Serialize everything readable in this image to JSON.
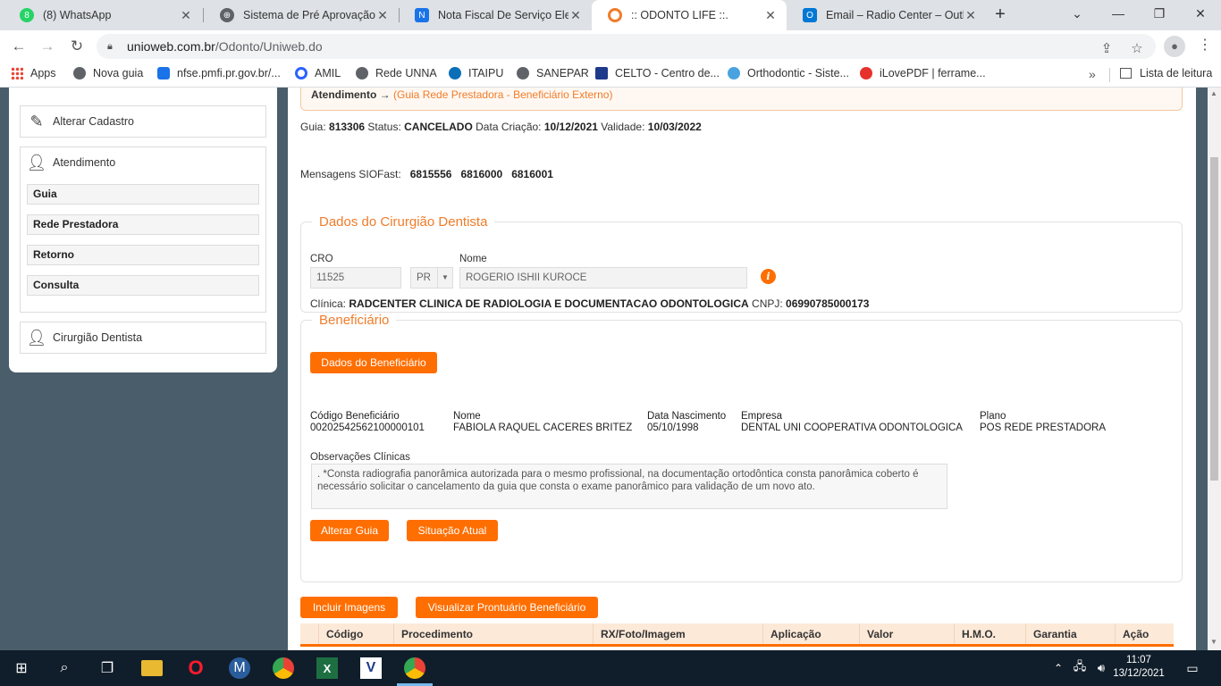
{
  "browser": {
    "tabs": [
      {
        "title": "(8) WhatsApp",
        "icon": "whatsapp-icon",
        "color": "#25d366",
        "active": false
      },
      {
        "title": "Sistema de Pré Aprovação",
        "icon": "globe-icon",
        "color": "#5f6368",
        "active": false
      },
      {
        "title": "Nota Fiscal De Serviço Eletrô",
        "icon": "nfse-icon",
        "color": "#1a73e8",
        "active": false
      },
      {
        "title": ":: ODONTO LIFE ::.",
        "icon": "odonto-icon",
        "color": "#f07c2a",
        "active": true
      },
      {
        "title": "Email – Radio Center – Outlo",
        "icon": "outlook-icon",
        "color": "#0078d4",
        "active": false
      }
    ],
    "new_tab": "+",
    "url_host": "unioweb.com.br",
    "url_path": "/Odonto/Uniweb.do",
    "bookmarks": [
      "Apps",
      "Nova guia",
      "nfse.pmfi.pr.gov.br/...",
      "AMIL",
      "Rede UNNA",
      "ITAIPU",
      "SANEPAR",
      "CELTO - Centro de...",
      "Orthodontic - Siste...",
      "iLovePDF | ferrame..."
    ],
    "reading_list": "Lista de leitura"
  },
  "sidebar": {
    "alterar_cadastro": "Alterar Cadastro",
    "atendimento": "Atendimento",
    "sub_items": [
      "Guia",
      "Rede Prestadora",
      "Retorno",
      "Consulta"
    ],
    "cirurgiao": "Cirurgião Dentista"
  },
  "main": {
    "breadcrumb_bold": "Atendimento →",
    "breadcrumb_sub": "(Guia Rede Prestadora - Beneficiário Externo)",
    "guia_label": "Guia:",
    "guia_value": "813306",
    "status_label": "Status:",
    "status_value": "CANCELADO",
    "criacao_label": "Data Criação:",
    "criacao_value": "10/12/2021",
    "validade_label": "Validade:",
    "validade_value": "10/03/2022",
    "mensagens_label": "Mensagens SIOFast:",
    "mensagens": [
      "6815556",
      "6816000",
      "6816001"
    ],
    "dentista": {
      "legend": "Dados do Cirurgião Dentista",
      "cro_label": "CRO",
      "cro_value": "11525",
      "uf_value": "PR",
      "nome_label": "Nome",
      "nome_value": "ROGERIO ISHII KUROCE",
      "clinica_label": "Clínica:",
      "clinica_value": "RADCENTER CLINICA DE RADIOLOGIA E DOCUMENTACAO ODONTOLOGICA",
      "cnpj_label": "CNPJ:",
      "cnpj_value": "06990785000173"
    },
    "beneficiario": {
      "legend": "Beneficiário",
      "dados_button": "Dados do Beneficiário",
      "codigo_label": "Código Beneficiário",
      "codigo_value": "00202542562100000101",
      "nome_label": "Nome",
      "nome_value": "FABIOLA RAQUEL CACERES BRITEZ",
      "nasc_label": "Data Nascimento",
      "nasc_value": "05/10/1998",
      "empresa_label": "Empresa",
      "empresa_value": "DENTAL UNI COOPERATIVA ODONTOLOGICA",
      "plano_label": "Plano",
      "plano_value": "POS REDE PRESTADORA",
      "obs_label": "Observações Clínicas",
      "obs_value": ". *Consta radiografia panorâmica autorizada para o mesmo profissional, na documentação ortodôntica consta panorâmica coberto é necessário solicitar o cancelamento da guia que consta o exame panorâmico para validação de um novo ato.",
      "alterar_button": "Alterar Guia",
      "situacao_button": "Situação Atual"
    },
    "incluir_button": "Incluir Imagens",
    "prontuario_button": "Visualizar Prontuário Beneficiário",
    "table_headers": [
      "",
      "Código",
      "Procedimento",
      "RX/Foto/Imagem",
      "Aplicação",
      "Valor",
      "H.M.O.",
      "Garantia",
      "Ação"
    ]
  },
  "taskbar": {
    "time": "11:07",
    "date": "13/12/2021"
  },
  "colors": {
    "accent": "#ff6e00",
    "sidebar_bg": "#4a5d6b",
    "taskbar": "#101e2b"
  }
}
